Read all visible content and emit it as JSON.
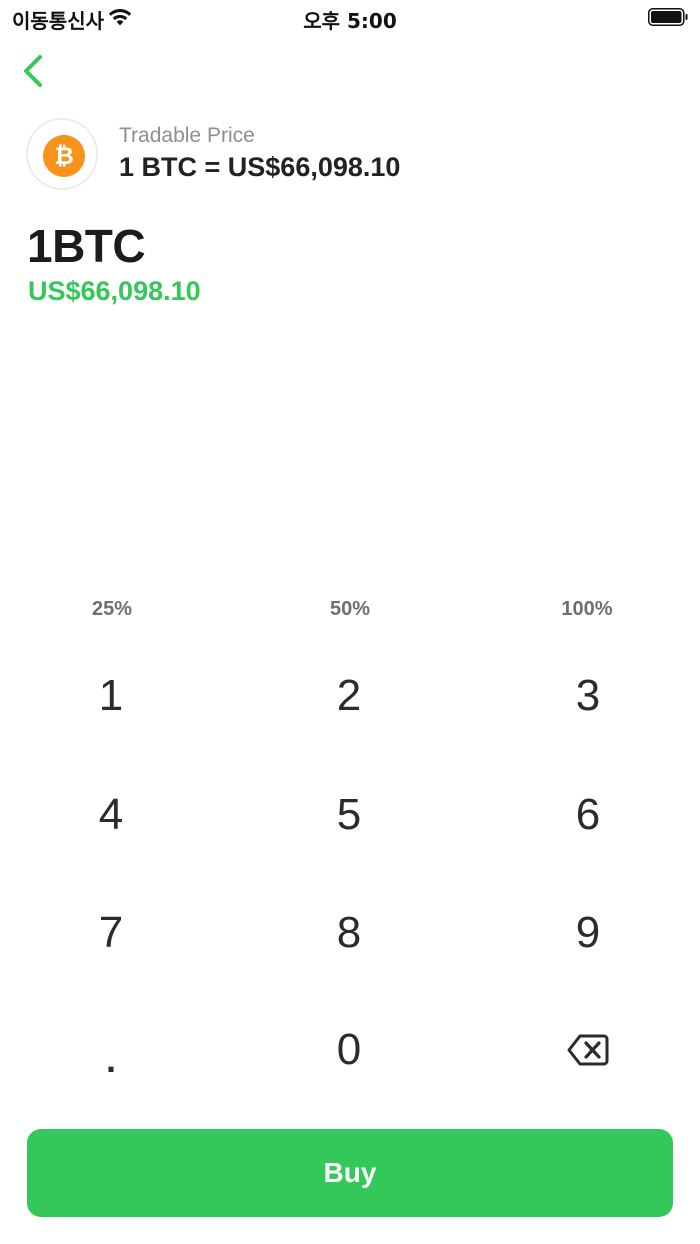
{
  "status_bar": {
    "carrier": "이동통신사",
    "time": "오후 5:00",
    "wifi_icon": "wifi-icon",
    "battery_icon": "battery-full-icon"
  },
  "nav": {
    "back_icon": "chevron-left-icon"
  },
  "price_header": {
    "coin_icon": "bitcoin-icon",
    "label": "Tradable Price",
    "value": "1 BTC = US$66,098.10"
  },
  "amount": {
    "crypto": "1BTC",
    "fiat": "US$66,098.10"
  },
  "percent_options": [
    "25%",
    "50%",
    "100%"
  ],
  "keypad": {
    "keys": [
      "1",
      "2",
      "3",
      "4",
      "5",
      "6",
      "7",
      "8",
      "9",
      ".",
      "0"
    ],
    "backspace_icon": "backspace-icon"
  },
  "buy_button": {
    "label": "Buy"
  },
  "colors": {
    "accent": "#34c759",
    "bitcoin": "#f7931a",
    "secondary_text": "#8e8e93"
  }
}
